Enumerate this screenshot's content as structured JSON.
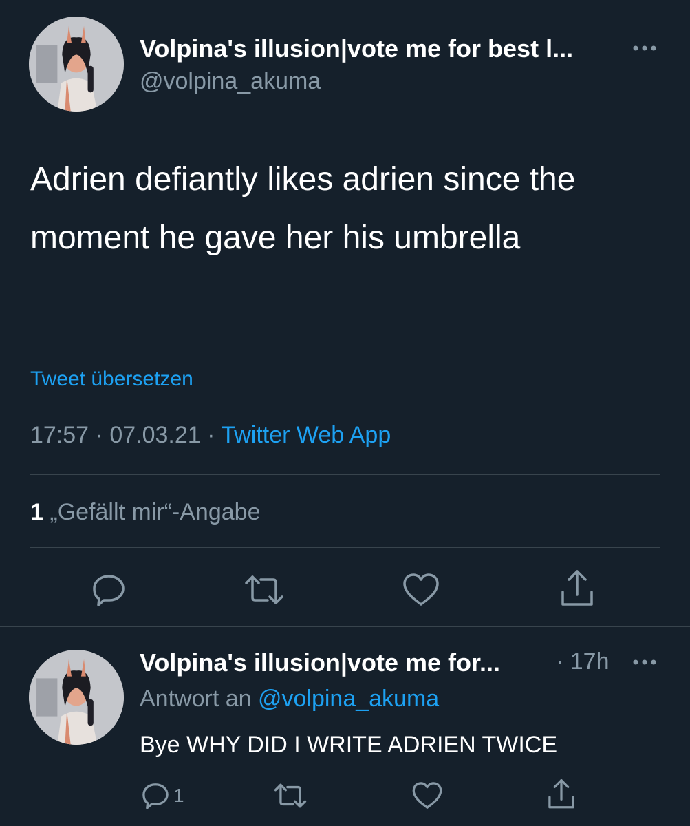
{
  "tweet": {
    "author_name": "Volpina's illusion|vote me for best l...",
    "author_handle": "@volpina_akuma",
    "more_icon": "more-dots-icon",
    "text": "Adrien defiantly likes adrien since the moment he gave her his umbrella",
    "translate_label": "Tweet übersetzen",
    "time": "17:57",
    "date": "07.03.21",
    "separator": "·",
    "source": "Twitter Web App",
    "likes_count": "1",
    "likes_label": "„Gefällt mir“-Angabe",
    "actions": [
      "reply-icon",
      "retweet-icon",
      "like-icon",
      "share-icon"
    ]
  },
  "reply": {
    "author_name": "Volpina's illusion|vote me for...",
    "age": "· 17h",
    "reply_to_prefix": "Antwort an",
    "reply_to_handle": "@volpina_akuma",
    "text": "Bye WHY DID I WRITE ADRIEN TWICE",
    "reply_count": "1",
    "actions": [
      "reply-icon",
      "retweet-icon",
      "like-icon",
      "share-icon"
    ]
  },
  "colors": {
    "background": "#15202b",
    "accent": "#1da1f2",
    "secondary_text": "#8899a6",
    "divider": "#38444d"
  }
}
